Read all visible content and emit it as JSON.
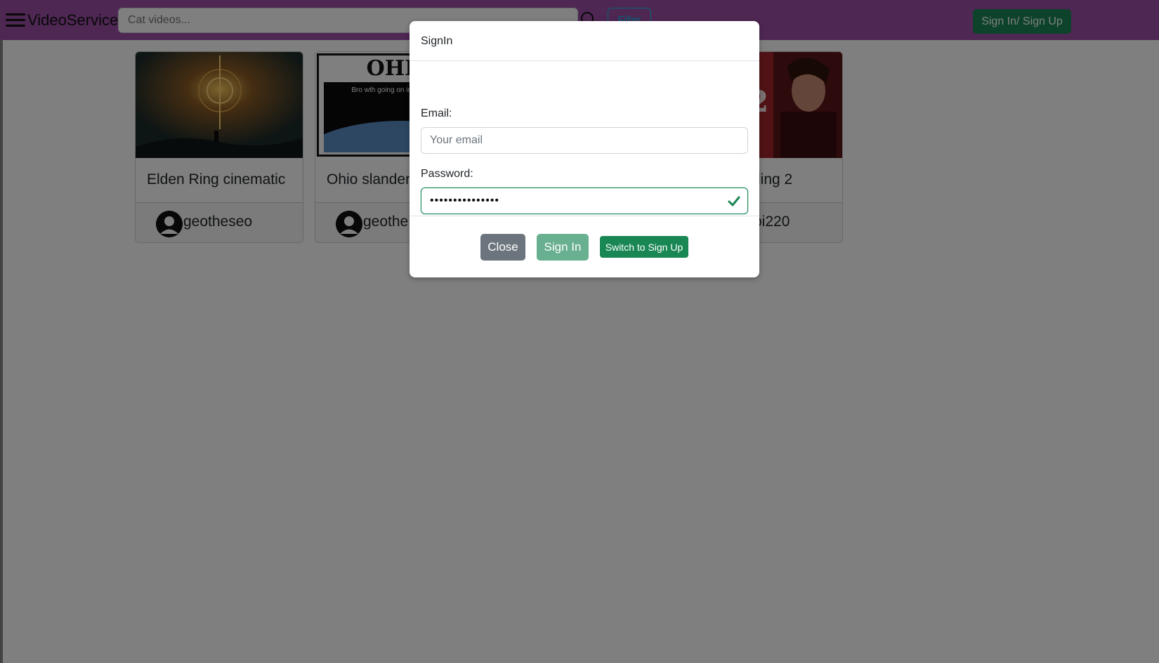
{
  "navbar": {
    "brand": "VideoService",
    "search_placeholder": "Cat videos...",
    "filter_label": "Filter",
    "signin_label": "Sign In/ Sign Up",
    "bg_color": "#9c4ea7"
  },
  "cards": [
    {
      "title": "Elden Ring cinematic",
      "author": "geotheseo"
    },
    {
      "title": "Ohio slander",
      "author": "geothe",
      "thumb_heading": "OHIO",
      "thumb_caption": "Bro wth going on in Ohio 👽👽"
    },
    {
      "title": "ding 2",
      "author": "pi220",
      "thumb_number": "2"
    }
  ],
  "modal": {
    "title": "SignIn",
    "email_label": "Email:",
    "email_placeholder": "Your email",
    "password_label": "Password:",
    "password_value": "•••••••••••••••",
    "close_label": "Close",
    "signin_label": "Sign In",
    "switch_label": "Switch to Sign Up"
  },
  "colors": {
    "success": "#198754",
    "secondary": "#6c757d",
    "info": "#0dcaf0"
  }
}
